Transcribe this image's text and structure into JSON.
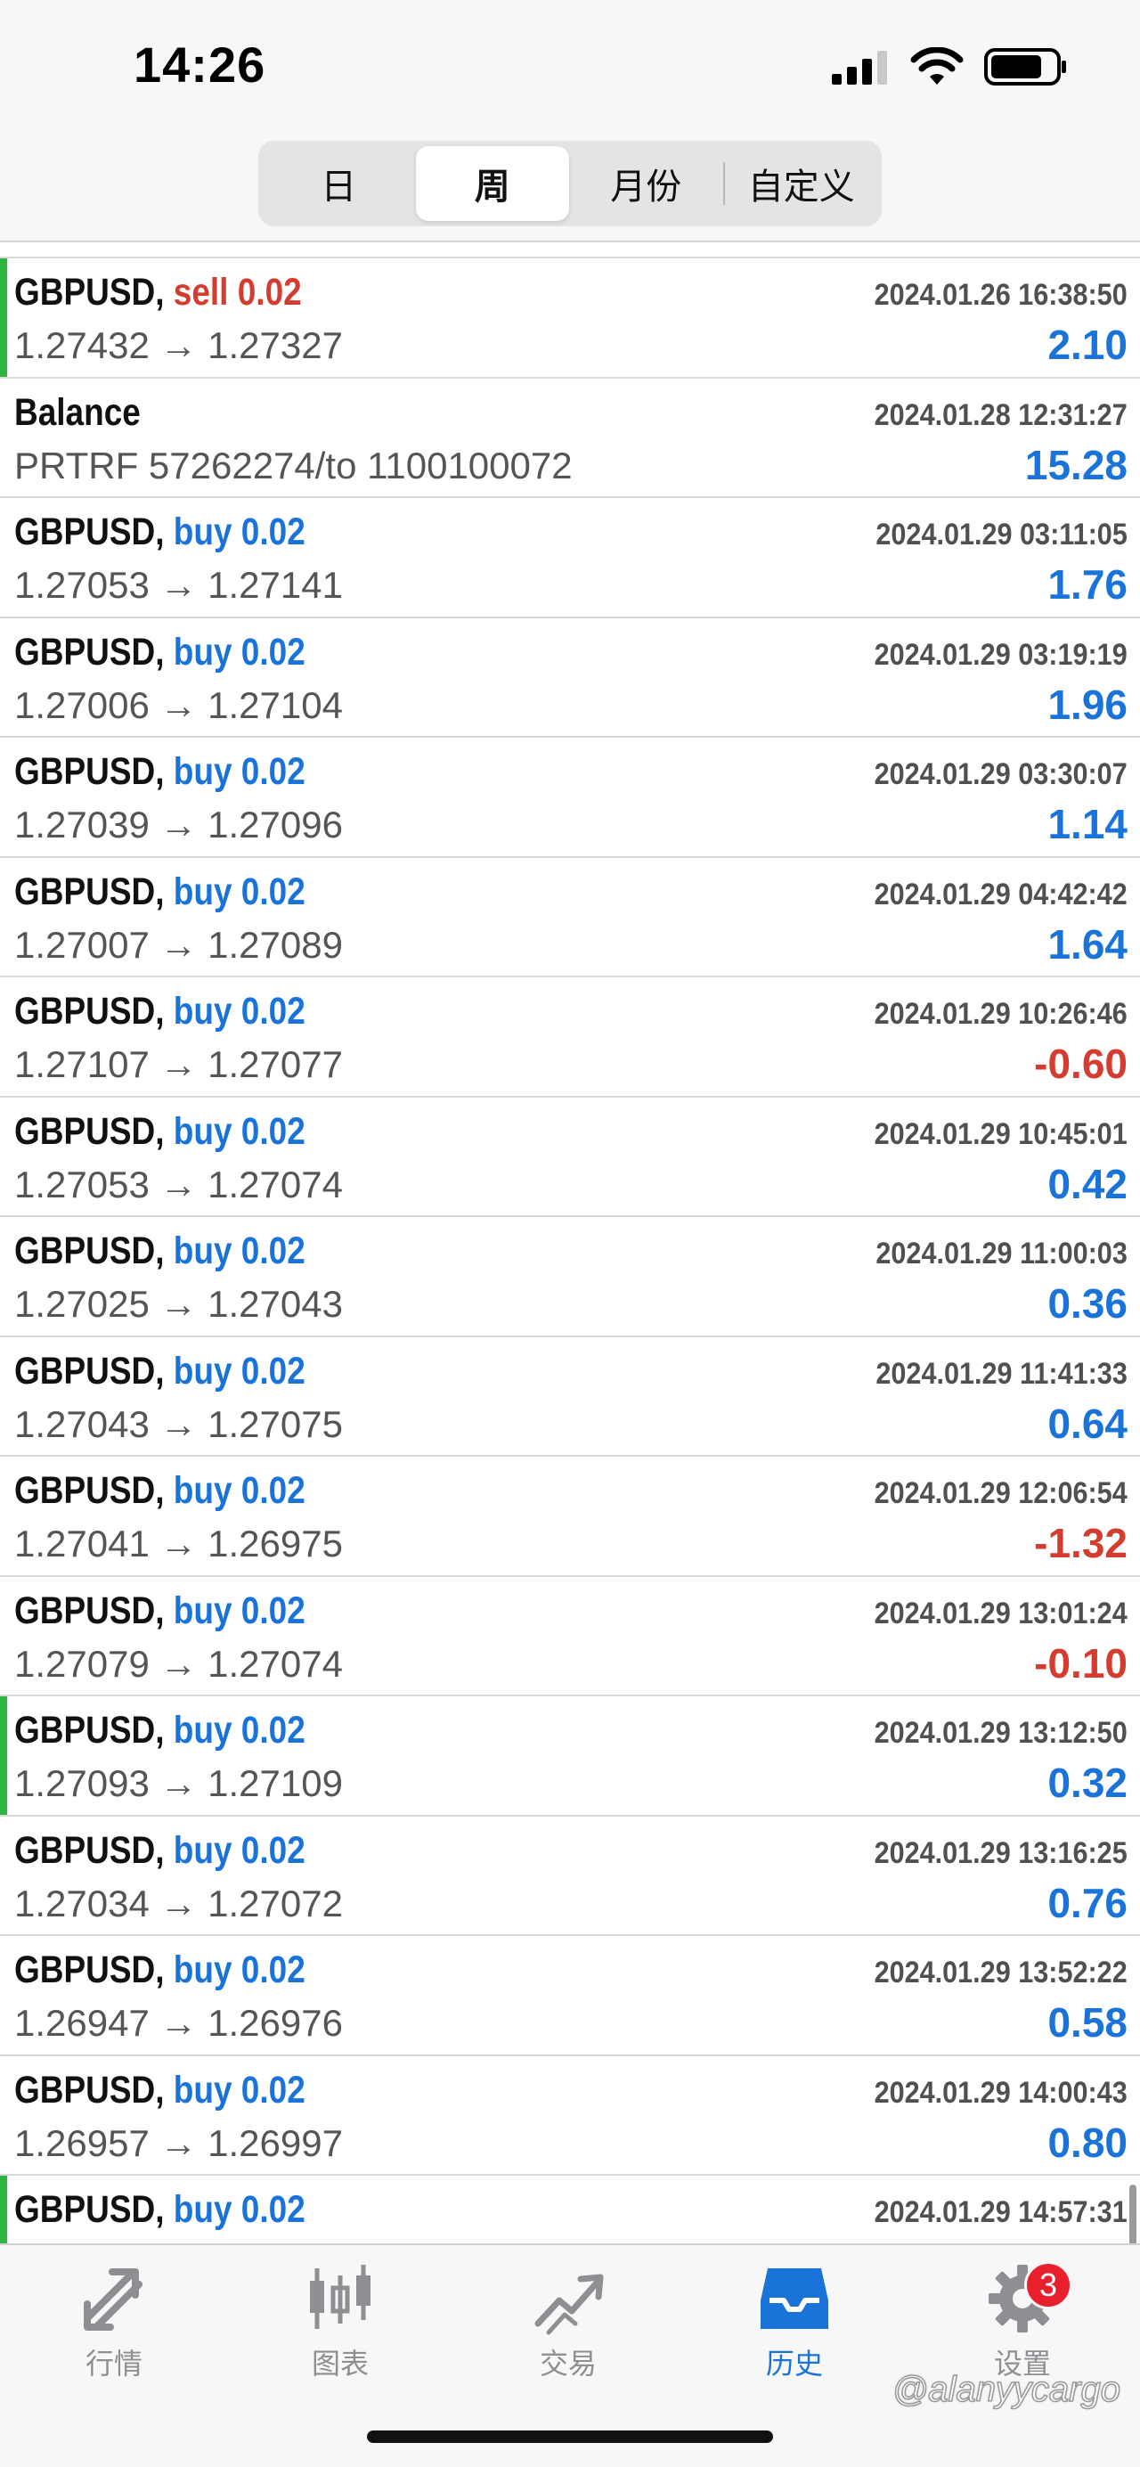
{
  "status_bar": {
    "time": "14:26"
  },
  "segments": [
    {
      "label": "日",
      "active": false
    },
    {
      "label": "周",
      "active": true
    },
    {
      "label": "月份",
      "active": false
    },
    {
      "label": "自定义",
      "active": false
    }
  ],
  "rows": [
    {
      "symbol": "GBPUSD,",
      "type": "sell",
      "lots": "sell 0.02",
      "prices": "1.27432 → 1.27327",
      "time": "2024.01.26 16:38:50",
      "profit": "2.10",
      "marked": true
    },
    {
      "symbol": "Balance",
      "type": "balance",
      "lots": "",
      "prices": "PRTRF 57262274/to 1100100072",
      "time": "2024.01.28 12:31:27",
      "profit": "15.28",
      "marked": false
    },
    {
      "symbol": "GBPUSD,",
      "type": "buy",
      "lots": "buy 0.02",
      "prices": "1.27053 → 1.27141",
      "time": "2024.01.29 03:11:05",
      "profit": "1.76",
      "marked": false
    },
    {
      "symbol": "GBPUSD,",
      "type": "buy",
      "lots": "buy 0.02",
      "prices": "1.27006 → 1.27104",
      "time": "2024.01.29 03:19:19",
      "profit": "1.96",
      "marked": false
    },
    {
      "symbol": "GBPUSD,",
      "type": "buy",
      "lots": "buy 0.02",
      "prices": "1.27039 → 1.27096",
      "time": "2024.01.29 03:30:07",
      "profit": "1.14",
      "marked": false
    },
    {
      "symbol": "GBPUSD,",
      "type": "buy",
      "lots": "buy 0.02",
      "prices": "1.27007 → 1.27089",
      "time": "2024.01.29 04:42:42",
      "profit": "1.64",
      "marked": false
    },
    {
      "symbol": "GBPUSD,",
      "type": "buy",
      "lots": "buy 0.02",
      "prices": "1.27107 → 1.27077",
      "time": "2024.01.29 10:26:46",
      "profit": "-0.60",
      "marked": false
    },
    {
      "symbol": "GBPUSD,",
      "type": "buy",
      "lots": "buy 0.02",
      "prices": "1.27053 → 1.27074",
      "time": "2024.01.29 10:45:01",
      "profit": "0.42",
      "marked": false
    },
    {
      "symbol": "GBPUSD,",
      "type": "buy",
      "lots": "buy 0.02",
      "prices": "1.27025 → 1.27043",
      "time": "2024.01.29 11:00:03",
      "profit": "0.36",
      "marked": false
    },
    {
      "symbol": "GBPUSD,",
      "type": "buy",
      "lots": "buy 0.02",
      "prices": "1.27043 → 1.27075",
      "time": "2024.01.29 11:41:33",
      "profit": "0.64",
      "marked": false
    },
    {
      "symbol": "GBPUSD,",
      "type": "buy",
      "lots": "buy 0.02",
      "prices": "1.27041 → 1.26975",
      "time": "2024.01.29 12:06:54",
      "profit": "-1.32",
      "marked": false
    },
    {
      "symbol": "GBPUSD,",
      "type": "buy",
      "lots": "buy 0.02",
      "prices": "1.27079 → 1.27074",
      "time": "2024.01.29 13:01:24",
      "profit": "-0.10",
      "marked": false
    },
    {
      "symbol": "GBPUSD,",
      "type": "buy",
      "lots": "buy 0.02",
      "prices": "1.27093 → 1.27109",
      "time": "2024.01.29 13:12:50",
      "profit": "0.32",
      "marked": true
    },
    {
      "symbol": "GBPUSD,",
      "type": "buy",
      "lots": "buy 0.02",
      "prices": "1.27034 → 1.27072",
      "time": "2024.01.29 13:16:25",
      "profit": "0.76",
      "marked": false
    },
    {
      "symbol": "GBPUSD,",
      "type": "buy",
      "lots": "buy 0.02",
      "prices": "1.26947 → 1.26976",
      "time": "2024.01.29 13:52:22",
      "profit": "0.58",
      "marked": false
    },
    {
      "symbol": "GBPUSD,",
      "type": "buy",
      "lots": "buy 0.02",
      "prices": "1.26957 → 1.26997",
      "time": "2024.01.29 14:00:43",
      "profit": "0.80",
      "marked": false
    },
    {
      "symbol": "GBPUSD,",
      "type": "buy",
      "lots": "buy 0.02",
      "prices": "",
      "time": "2024.01.29 14:57:31",
      "profit": "",
      "marked": true
    }
  ],
  "tabs": [
    {
      "label": "行情",
      "icon": "quotes-icon",
      "active": false
    },
    {
      "label": "图表",
      "icon": "chart-icon",
      "active": false
    },
    {
      "label": "交易",
      "icon": "trade-icon",
      "active": false
    },
    {
      "label": "历史",
      "icon": "history-icon",
      "active": true
    },
    {
      "label": "设置",
      "icon": "settings-icon",
      "active": false,
      "badge": "3"
    }
  ],
  "watermark": "@alanyycargo",
  "colors": {
    "buy": "#1a73d9",
    "sell": "#d43c30",
    "marker": "#2fb540",
    "tab_active": "#1a73d9",
    "tab_inactive": "#8e8e93",
    "badge": "#e8202e"
  }
}
